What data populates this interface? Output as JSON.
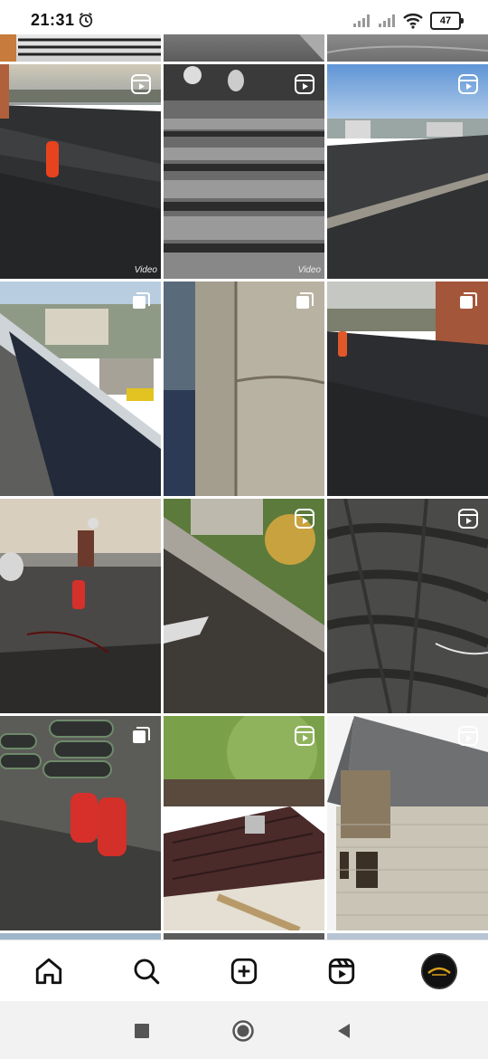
{
  "status_bar": {
    "time": "21:31",
    "battery": "47",
    "icons": [
      "alarm-icon",
      "signal-icon",
      "signal-icon",
      "wifi-icon",
      "battery-icon"
    ]
  },
  "grid": {
    "overlay_label": "Video",
    "tiles": [
      {
        "kind": "partial-top",
        "badge": "none"
      },
      {
        "kind": "partial-top",
        "badge": "none"
      },
      {
        "kind": "partial-top",
        "badge": "none"
      },
      {
        "kind": "roof-photo",
        "badge": "reels-icon"
      },
      {
        "kind": "roof-photo",
        "badge": "reels-icon"
      },
      {
        "kind": "roof-photo",
        "badge": "reels-icon"
      },
      {
        "kind": "roof-photo",
        "badge": "carousel-icon"
      },
      {
        "kind": "roof-photo",
        "badge": "carousel-icon"
      },
      {
        "kind": "roof-photo",
        "badge": "carousel-icon"
      },
      {
        "kind": "roof-photo",
        "badge": "none"
      },
      {
        "kind": "roof-photo",
        "badge": "reels-icon"
      },
      {
        "kind": "roof-photo",
        "badge": "reels-icon"
      },
      {
        "kind": "roof-photo",
        "badge": "carousel-icon"
      },
      {
        "kind": "roof-photo",
        "badge": "reels-icon"
      },
      {
        "kind": "house-photo",
        "badge": "reels-icon"
      }
    ]
  },
  "bottom_nav": {
    "items": [
      "home-icon",
      "search-icon",
      "create-icon",
      "reels-icon",
      "profile-avatar"
    ]
  },
  "system_nav": {
    "items": [
      "recents-button",
      "home-button",
      "back-button"
    ]
  }
}
